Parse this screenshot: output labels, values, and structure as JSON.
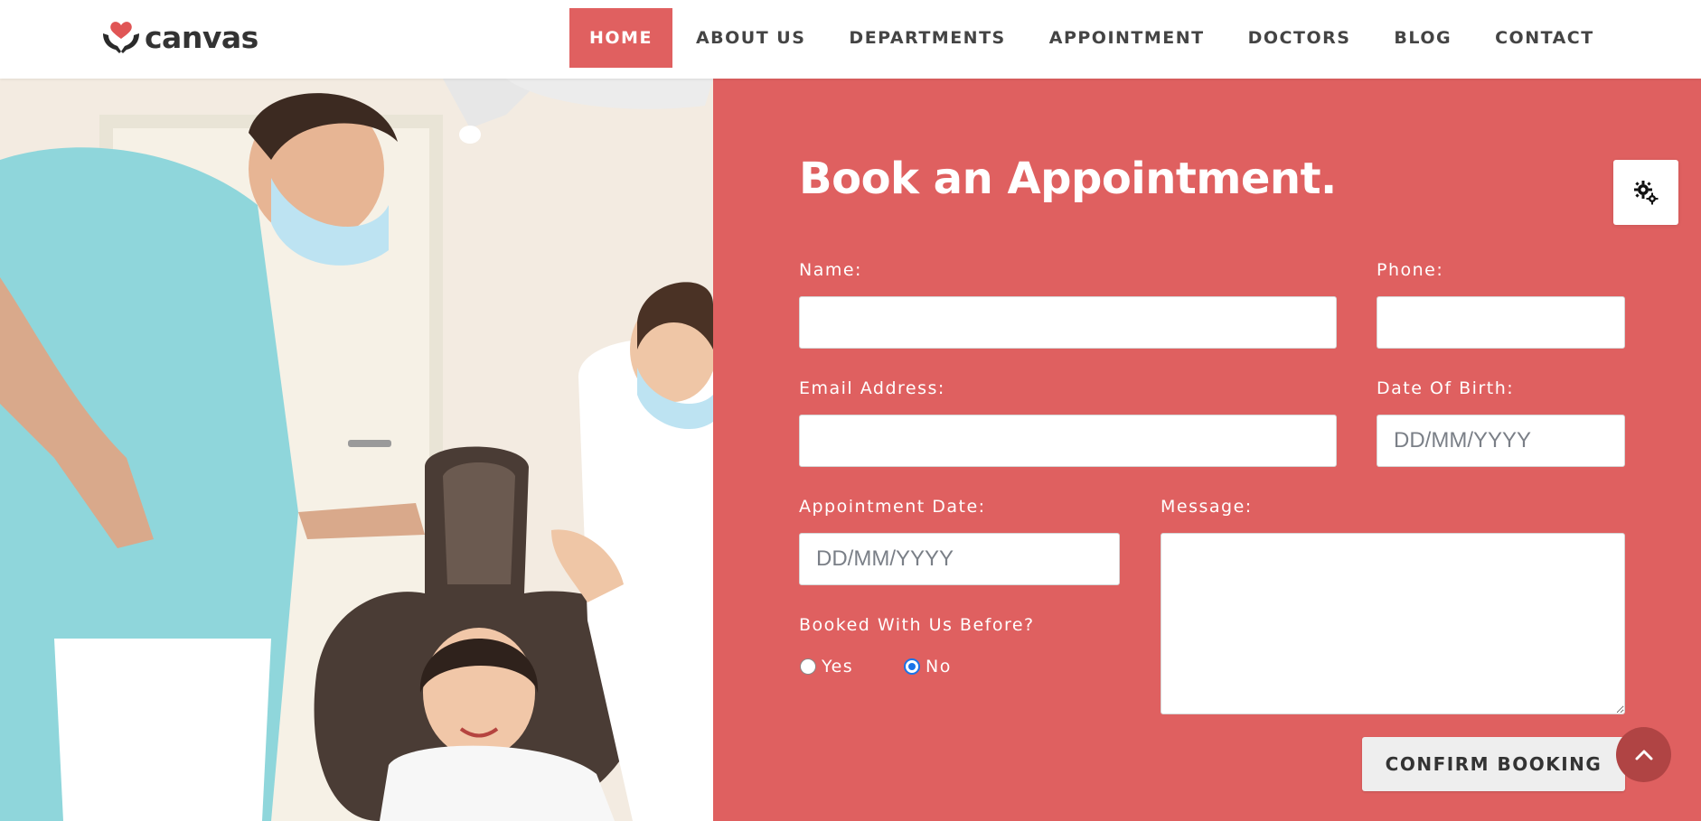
{
  "header": {
    "brand": "canvas",
    "logo_icon": "heart-hands-icon",
    "nav": [
      {
        "label": "HOME",
        "active": true
      },
      {
        "label": "ABOUT US",
        "active": false
      },
      {
        "label": "DEPARTMENTS",
        "active": false
      },
      {
        "label": "APPOINTMENT",
        "active": false
      },
      {
        "label": "DOCTORS",
        "active": false
      },
      {
        "label": "BLOG",
        "active": false
      },
      {
        "label": "CONTACT",
        "active": false
      }
    ]
  },
  "form": {
    "title": "Book an Appointment.",
    "name_label": "Name:",
    "name_value": "",
    "phone_label": "Phone:",
    "phone_value": "",
    "email_label": "Email Address:",
    "email_value": "",
    "dob_label": "Date Of Birth:",
    "dob_placeholder": "DD/MM/YYYY",
    "appt_date_label": "Appointment Date:",
    "appt_date_placeholder": "DD/MM/YYYY",
    "message_label": "Message:",
    "message_value": "",
    "booked_before_label": "Booked With Us Before?",
    "options": [
      {
        "label": "Yes",
        "checked": false
      },
      {
        "label": "No",
        "checked": true
      }
    ],
    "submit_label": "CONFIRM BOOKING"
  },
  "colors": {
    "accent": "#df6060",
    "accent_dark": "#b04444",
    "nav_text": "#444444",
    "button_bg": "#eeeeee",
    "radio_checked": "#1a73e8"
  },
  "icons": {
    "settings": "gears-icon",
    "scroll_top": "chevron-up-icon"
  }
}
